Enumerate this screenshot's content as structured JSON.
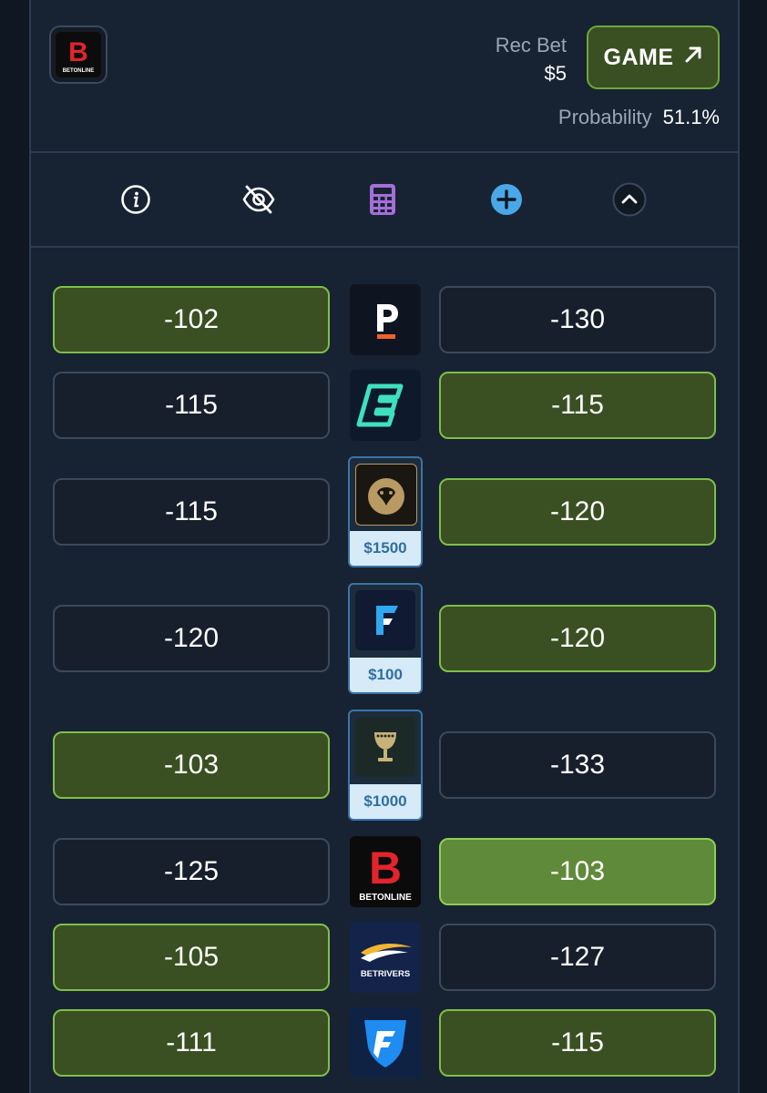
{
  "header": {
    "sportsbook_icon": "betonline-logo",
    "rec_bet_label": "Rec Bet",
    "rec_bet_amount": "$5",
    "game_button_label": "GAME",
    "game_button_icon": "arrow-up-right-icon",
    "probability_label": "Probability",
    "probability_value": "51.1%"
  },
  "toolbar": {
    "icons": [
      "info-icon",
      "eye-off-icon",
      "calculator-icon",
      "plus-circle-icon",
      "chevron-up-icon"
    ]
  },
  "rows": [
    {
      "book": "prizepicks-style-p",
      "left": "-102",
      "right": "-130",
      "left_state": "best",
      "right_state": "plain",
      "bonus": ""
    },
    {
      "book": "betr-e",
      "left": "-115",
      "right": "-115",
      "left_state": "plain",
      "right_state": "best",
      "bonus": ""
    },
    {
      "book": "betmgm-lion",
      "left": "-115",
      "right": "-120",
      "left_state": "plain",
      "right_state": "best",
      "bonus": "$1500"
    },
    {
      "book": "fanatics-f",
      "left": "-120",
      "right": "-120",
      "left_state": "plain",
      "right_state": "best",
      "bonus": "$100"
    },
    {
      "book": "caesars-goblet",
      "left": "-103",
      "right": "-133",
      "left_state": "best",
      "right_state": "plain",
      "bonus": "$1000"
    },
    {
      "book": "betonline",
      "left": "-125",
      "right": "-103",
      "left_state": "plain",
      "right_state": "top",
      "bonus": ""
    },
    {
      "book": "betrivers",
      "left": "-105",
      "right": "-127",
      "left_state": "best",
      "right_state": "plain",
      "bonus": ""
    },
    {
      "book": "fanduel-shield",
      "left": "-111",
      "right": "-115",
      "left_state": "best",
      "right_state": "best",
      "bonus": ""
    }
  ],
  "logo_text": {
    "betonline_small": "BETONLINE",
    "betrivers": "BETRIVERS"
  },
  "colors": {
    "background": "#0e1722",
    "card": "#172332",
    "best_fill": "#3a4f22",
    "top_fill": "#5f8a3a",
    "accent_green": "#7fbf4a",
    "bonus_text": "#2f6fa2"
  }
}
